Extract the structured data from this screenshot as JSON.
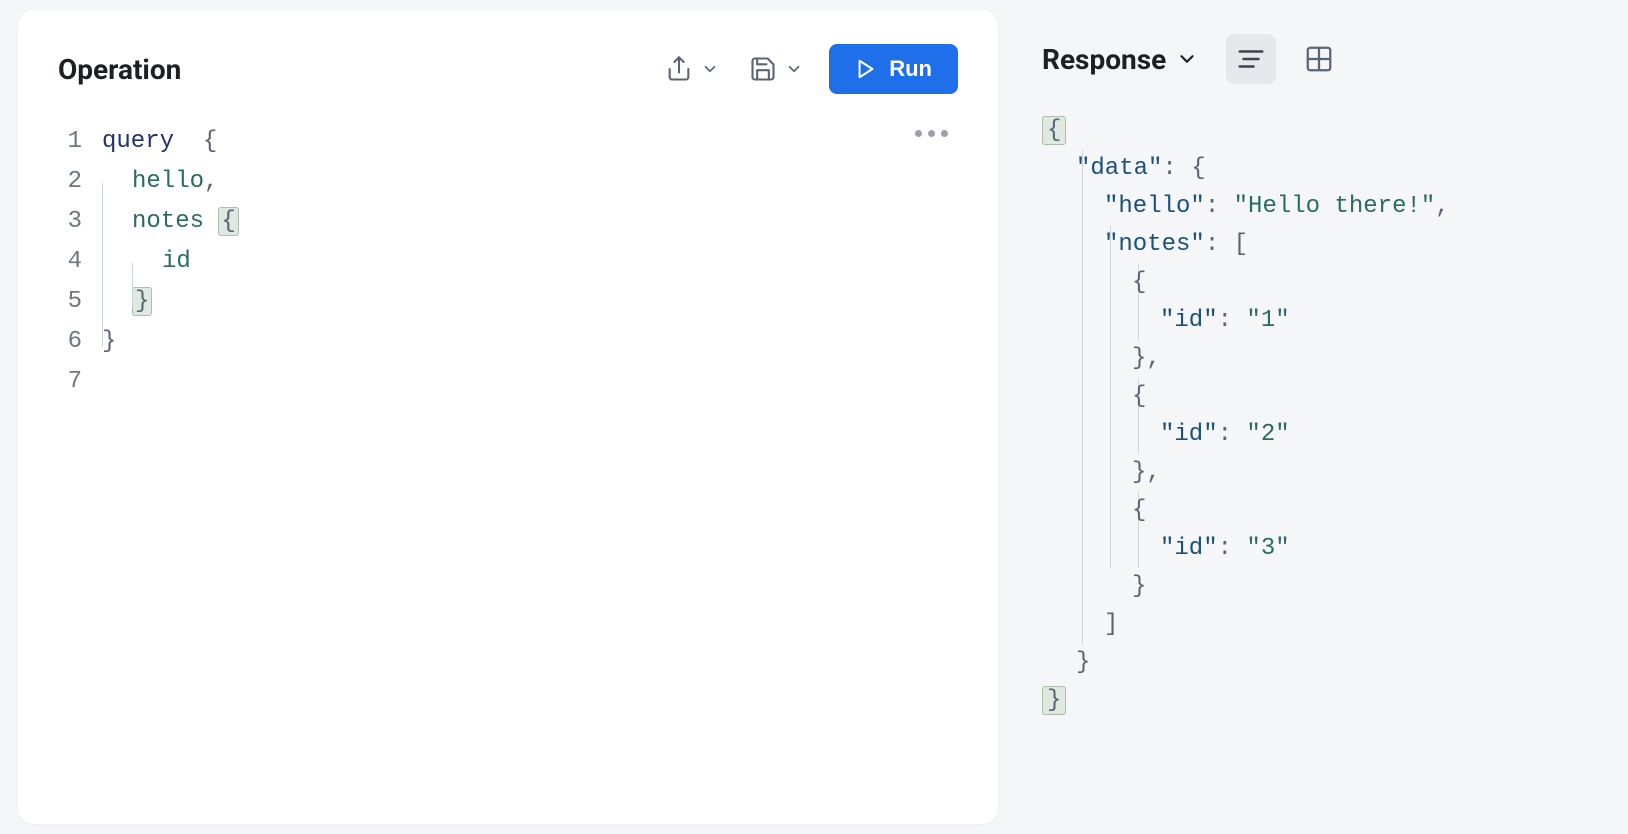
{
  "operation": {
    "title": "Operation",
    "run_label": "Run",
    "code_tokens": {
      "kw_query": "query",
      "field_hello": "hello",
      "field_notes": "notes",
      "field_id": "id"
    },
    "line_numbers": [
      "1",
      "2",
      "3",
      "4",
      "5",
      "6",
      "7"
    ]
  },
  "response": {
    "title": "Response",
    "json": {
      "data_key": "\"data\"",
      "hello_key": "\"hello\"",
      "hello_val": "\"Hello there!\"",
      "notes_key": "\"notes\"",
      "id_key": "\"id\"",
      "id_vals": [
        "\"1\"",
        "\"2\"",
        "\"3\""
      ]
    }
  }
}
